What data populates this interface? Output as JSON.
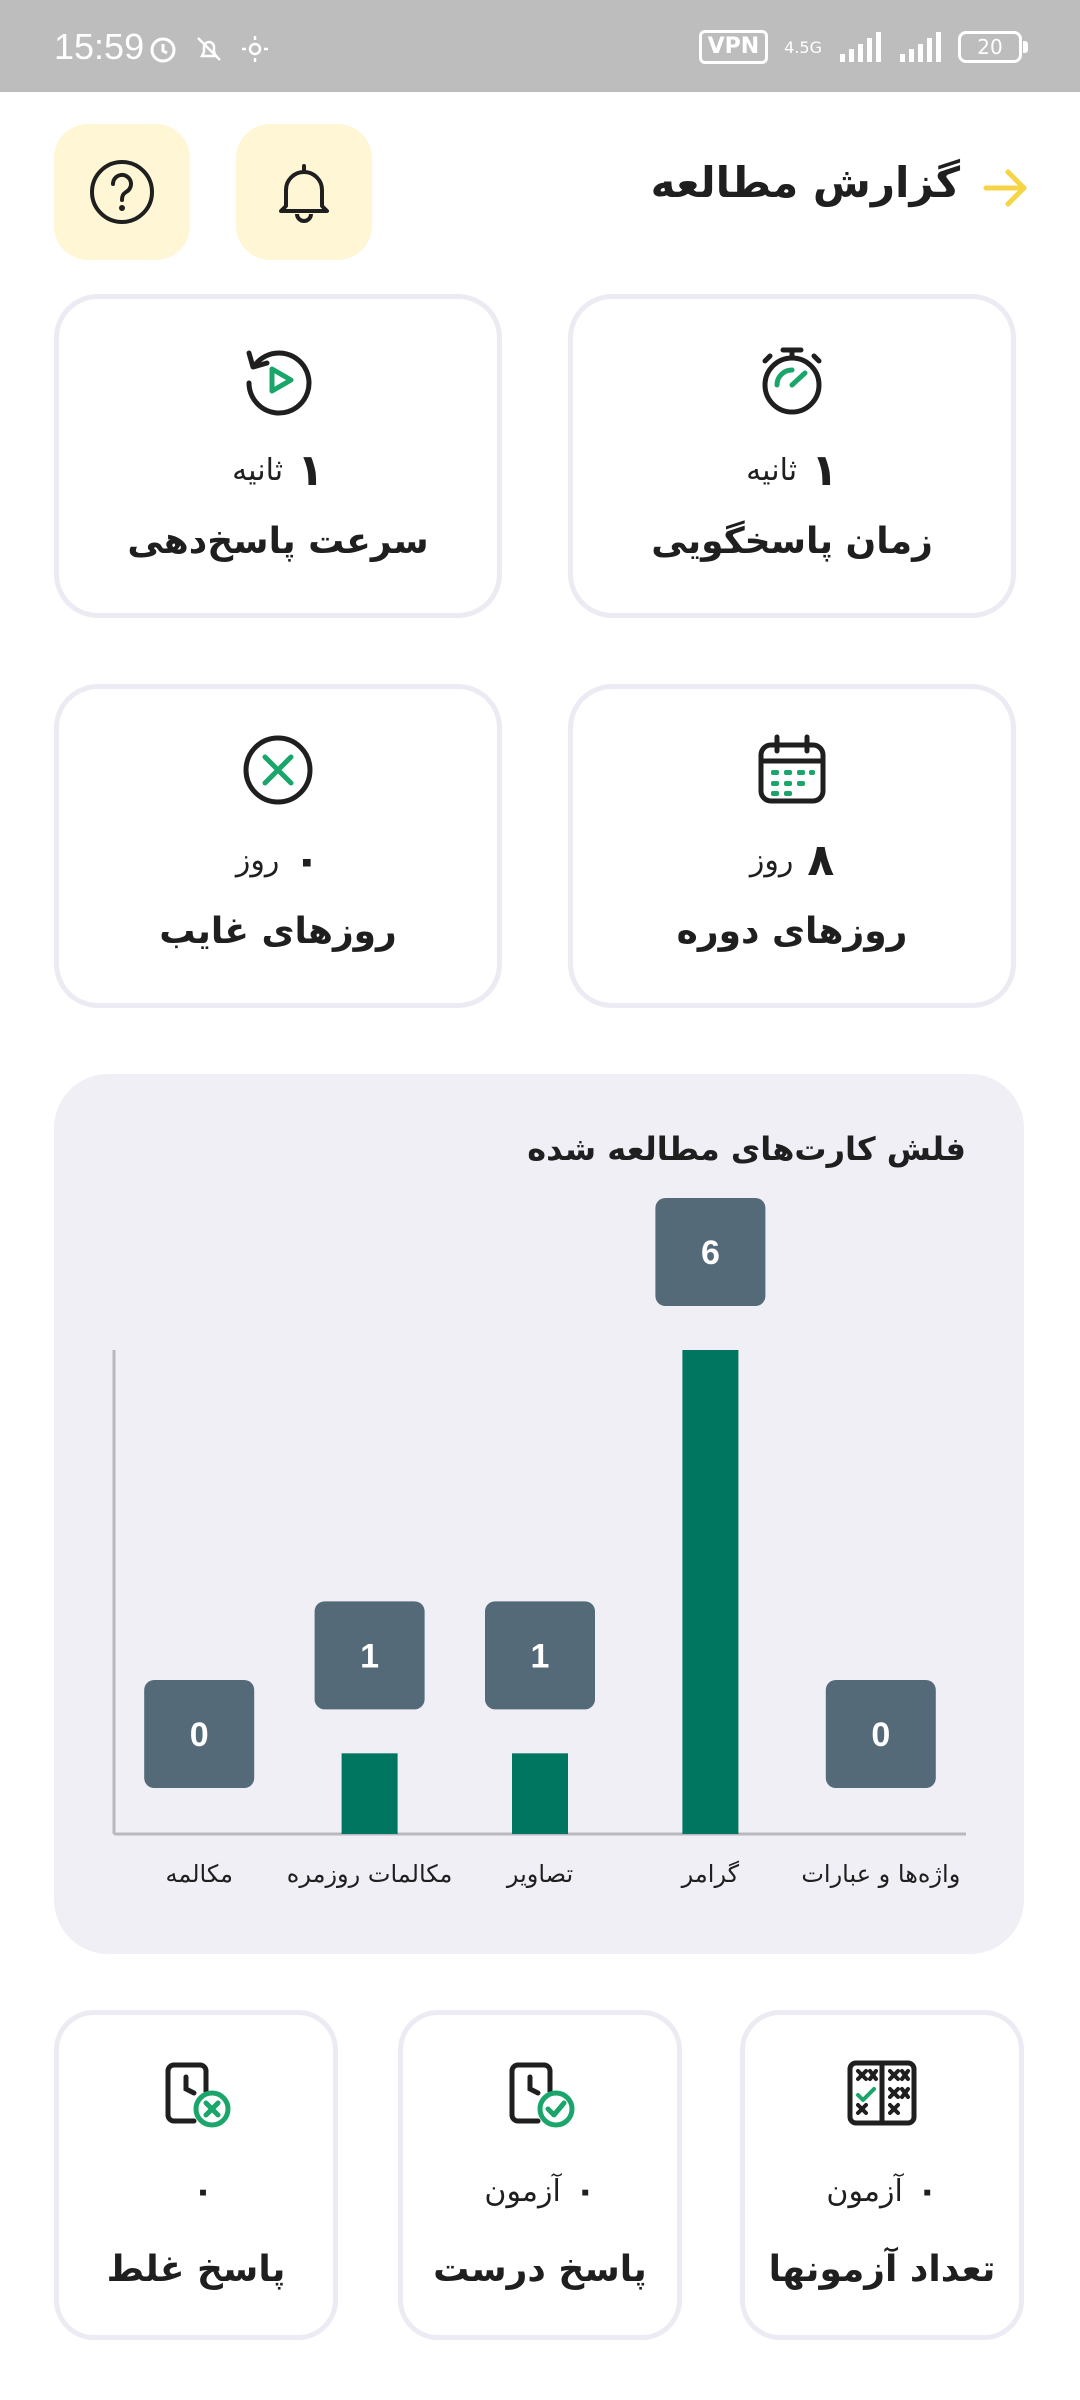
{
  "status_bar": {
    "time": "15:59",
    "vpn": "VPN",
    "network": "4.5G",
    "battery": "20",
    "icons": [
      "alarm-icon",
      "mute-icon",
      "brightness-icon",
      "signal-icon",
      "signal-icon-2"
    ]
  },
  "header": {
    "title": "گزارش مطالعه",
    "back_icon": "arrow-right-icon",
    "notification_icon": "bell-icon",
    "help_icon": "question-icon",
    "accent_color": "#f5d547",
    "button_bg": "#fff6d6"
  },
  "stats": {
    "response_time": {
      "value": "۱",
      "unit": "ثانیه",
      "label": "زمان پاسخگویی",
      "icon": "stopwatch-icon"
    },
    "response_speed": {
      "value": "۱",
      "unit": "ثانیه",
      "label": "سرعت پاسخ‌دهی",
      "icon": "replay-icon"
    },
    "course_days": {
      "value": "۸",
      "unit": "روز",
      "label": "روزهای دوره",
      "icon": "calendar-icon"
    },
    "absent_days": {
      "value": "۰",
      "unit": "روز",
      "label": "روزهای غایب",
      "icon": "x-circle-icon"
    }
  },
  "chart": {
    "title": "فلش کارت‌های مطالعه شده"
  },
  "chart_data": {
    "type": "bar",
    "categories": [
      "واژه‌ها و عبارات",
      "گرامر",
      "تصاویر",
      "مکالمات روزمره",
      "مکالمه"
    ],
    "values": [
      0,
      6,
      1,
      1,
      0
    ],
    "title": "فلش کارت‌های مطالعه شده",
    "xlabel": "",
    "ylabel": "",
    "ylim": [
      0,
      6
    ],
    "grid": false,
    "bar_color": "#00755f",
    "label_bg": "#546a78"
  },
  "quiz_stats": {
    "total": {
      "value": "۰",
      "unit": "آزمون",
      "label": "تعداد آزمونها",
      "icon": "quiz-grid-icon"
    },
    "correct": {
      "value": "۰",
      "unit": "آزمون",
      "label": "پاسخ درست",
      "icon": "clipboard-check-icon"
    },
    "wrong": {
      "value": "۰",
      "unit": "",
      "label": "پاسخ غلط",
      "icon": "clipboard-x-icon"
    }
  },
  "colors": {
    "green": "#1aa56a",
    "card_border": "#eceaf3",
    "chart_bg": "#f1eff6"
  }
}
